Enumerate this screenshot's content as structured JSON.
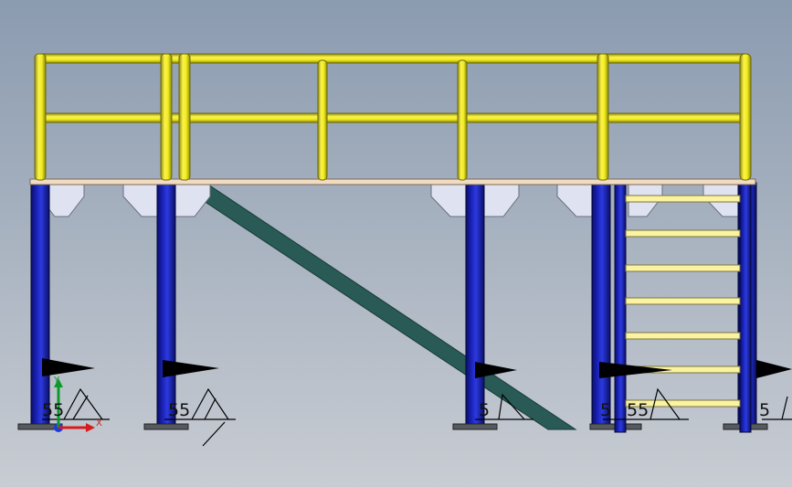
{
  "viewport": {
    "name": "cad-graphics-area",
    "colors": {
      "rail": "#f2ec1e",
      "rail_dark": "#8c8a10",
      "column": "#1a22b8",
      "column_dark": "#0a0f66",
      "deck": "#f1dcc2",
      "gusset": "#dfe2f0",
      "brace": "#2a5a55",
      "ladder_rung": "#fbf3a0",
      "weld_symbol": "#000000"
    }
  },
  "weld_labels": [
    "55",
    "55",
    "5",
    "5",
    "55",
    "5"
  ],
  "triad": {
    "x_label": "X",
    "y_label": "Y"
  }
}
